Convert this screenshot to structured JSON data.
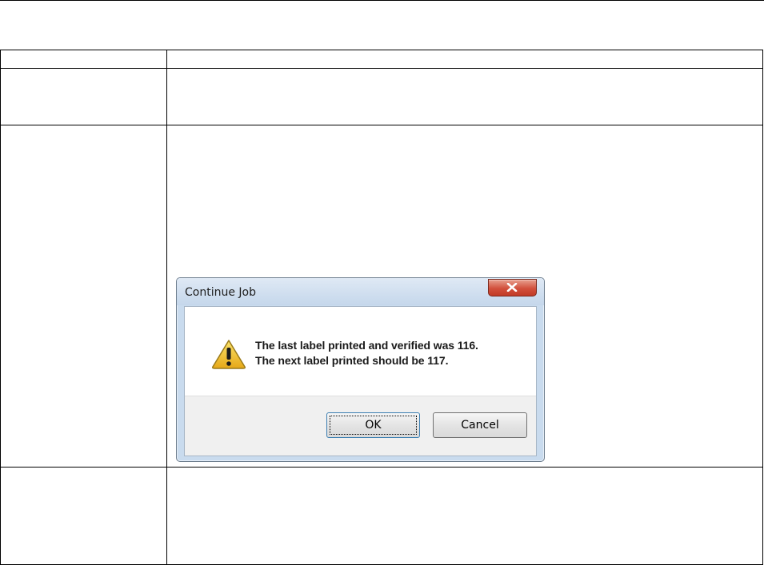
{
  "dialog": {
    "title": "Continue Job",
    "message_line1": "The last label printed and verified was 116.",
    "message_line2": "The next label printed should be 117.",
    "ok_label": "OK",
    "cancel_label": "Cancel",
    "icons": {
      "close": "close-icon",
      "warning": "warning-icon"
    },
    "colors": {
      "close_button": "#c94431",
      "ok_focus_border": "#3c7fb1",
      "footer": "#f0f0f0"
    }
  }
}
